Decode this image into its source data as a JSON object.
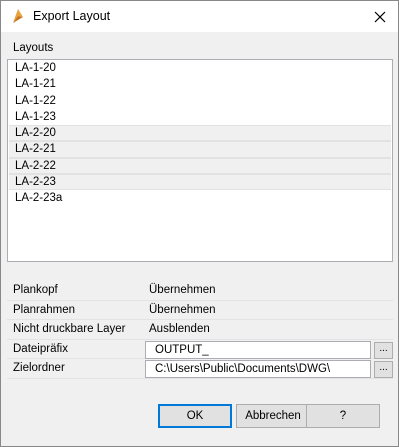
{
  "window": {
    "title": "Export Layout"
  },
  "layouts": {
    "label": "Layouts",
    "items": [
      {
        "name": "LA-1-20",
        "selected": false
      },
      {
        "name": "LA-1-21",
        "selected": false
      },
      {
        "name": "LA-1-22",
        "selected": false
      },
      {
        "name": "LA-1-23",
        "selected": false
      },
      {
        "name": "LA-2-20",
        "selected": true
      },
      {
        "name": "LA-2-21",
        "selected": true
      },
      {
        "name": "LA-2-22",
        "selected": true
      },
      {
        "name": "LA-2-23",
        "selected": true
      },
      {
        "name": "LA-2-23a",
        "selected": false
      }
    ]
  },
  "properties": {
    "plankopf": {
      "label": "Plankopf",
      "value": "Übernehmen"
    },
    "planrahmen": {
      "label": "Planrahmen",
      "value": "Übernehmen"
    },
    "nicht_druckbare_layer": {
      "label": "Nicht druckbare Layer",
      "value": "Ausblenden"
    },
    "dateipraefix": {
      "label": "Dateipräfix",
      "value": "OUTPUT_",
      "browse_label": "..."
    },
    "zielordner": {
      "label": "Zielordner",
      "value": "C:\\Users\\Public\\Documents\\DWG\\",
      "browse_label": "..."
    }
  },
  "buttons": {
    "ok": "OK",
    "cancel": "Abbrechen",
    "help": "?"
  },
  "colors": {
    "accent": "#0078d7",
    "app_icon_primary": "#e8a33d",
    "app_icon_secondary": "#c6731b"
  }
}
